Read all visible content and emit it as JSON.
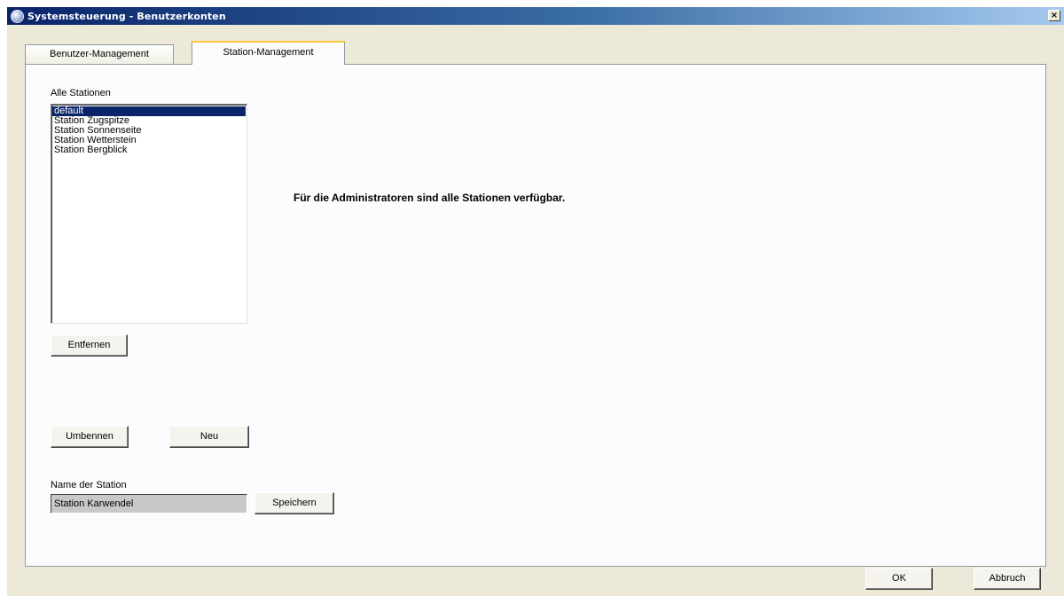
{
  "window": {
    "title": "Systemsteuerung - Benutzerkonten",
    "close_label": "×"
  },
  "tabs": [
    {
      "label": "Benutzer-Management",
      "active": false
    },
    {
      "label": "Station-Management",
      "active": true
    }
  ],
  "stations": {
    "list_label": "Alle Stationen",
    "items": [
      "default",
      "Station Zugspitze",
      "Station Sonnenseite",
      "Station Wetterstein",
      "Station Bergblick"
    ],
    "selected": "default"
  },
  "info_text": "Für die Administratoren sind alle Stationen verfügbar.",
  "buttons": {
    "remove": "Entfernen",
    "rename": "Umbennen",
    "new": "Neu",
    "save": "Speichern",
    "ok": "OK",
    "cancel": "Abbruch"
  },
  "station_name": {
    "label": "Name der Station",
    "value": "Station Karwendel"
  },
  "colors": {
    "title_gradient_start": "#0a246a",
    "selection": "#0a246a",
    "tab_highlight": "#ffc83c",
    "dialog_bg": "#ece9d8"
  }
}
